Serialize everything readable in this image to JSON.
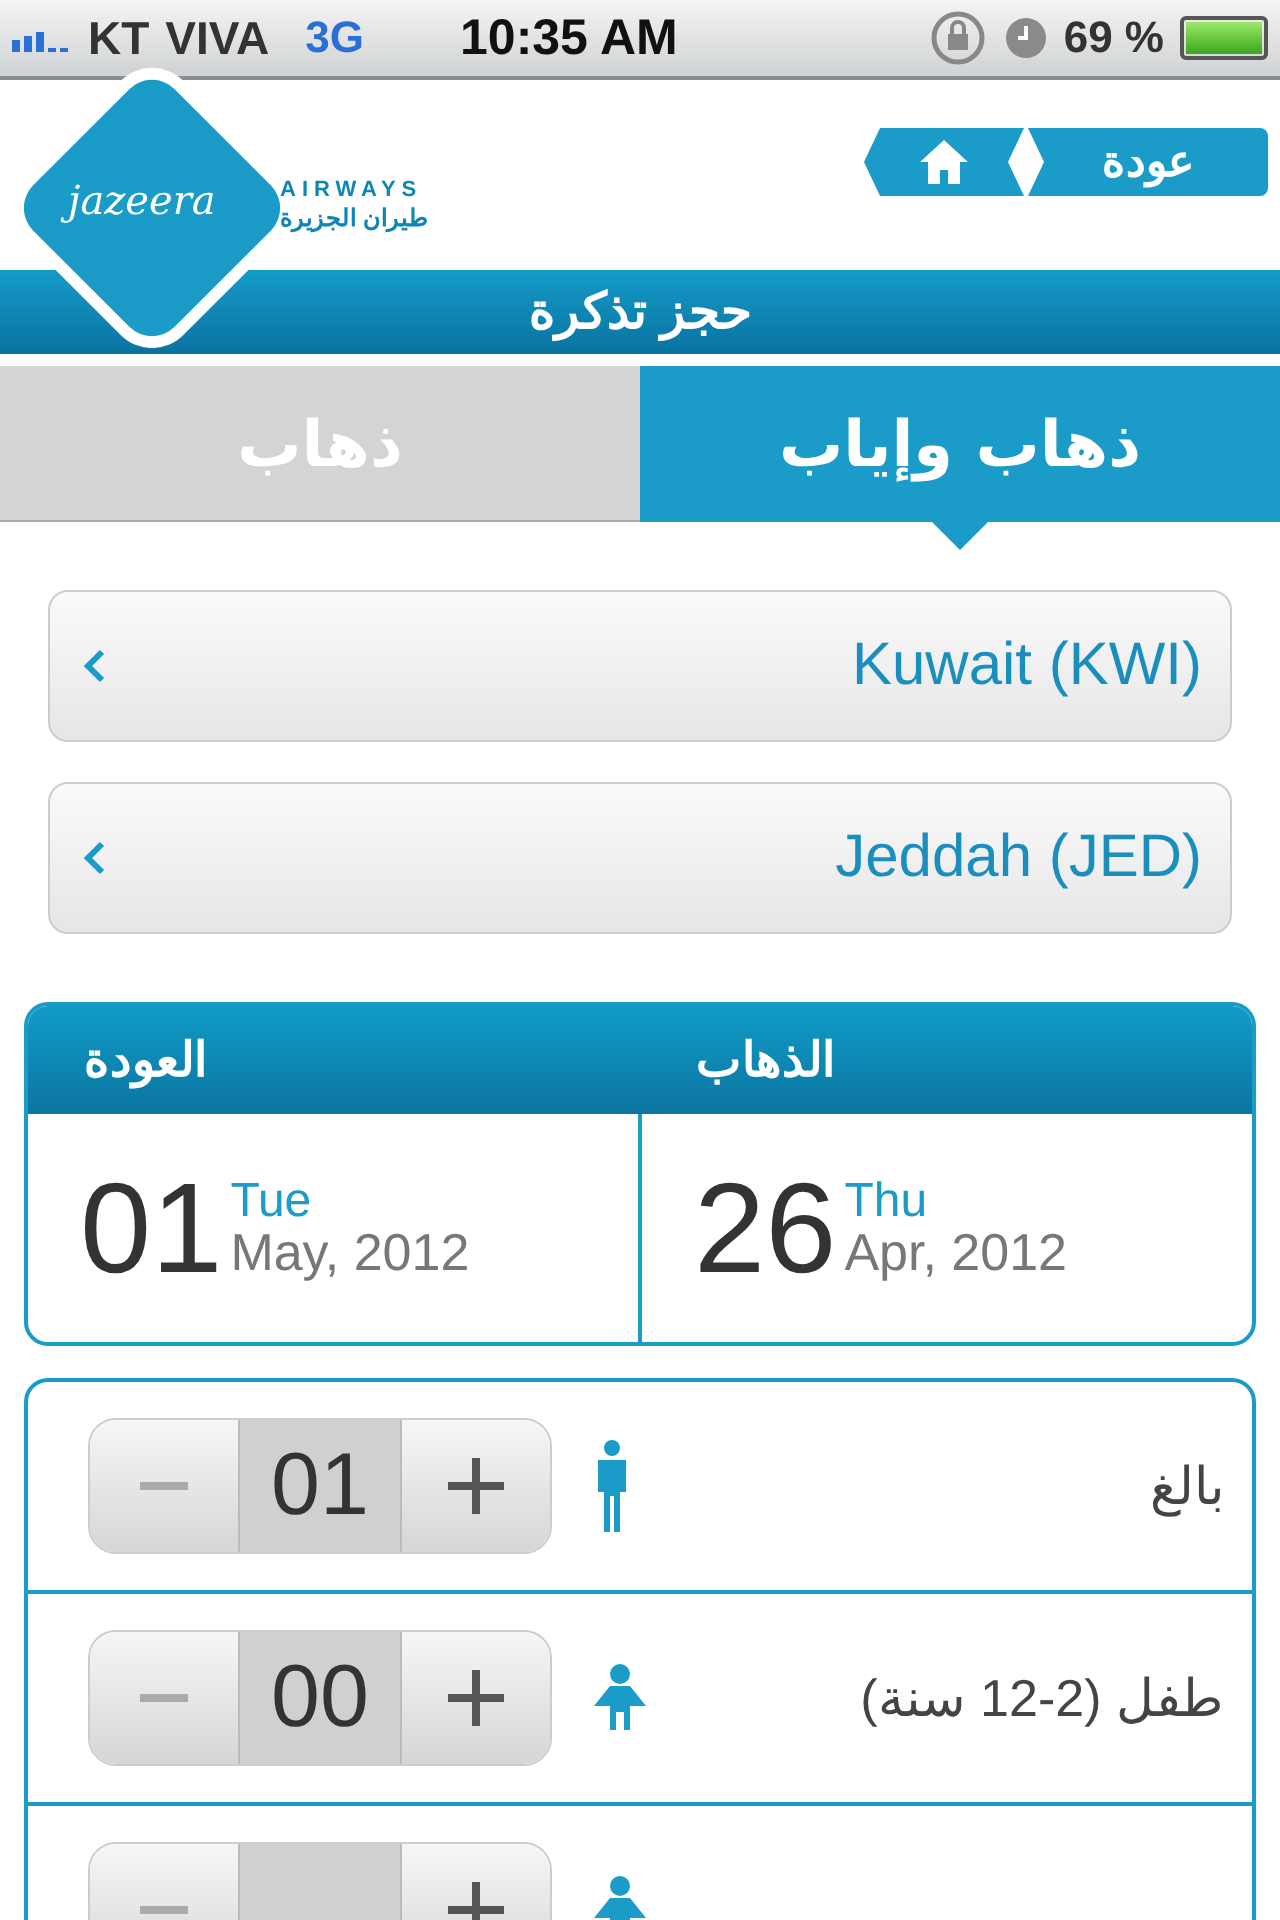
{
  "status_bar": {
    "carrier": "KT",
    "carrier_2": "VIVA",
    "network": "3G",
    "time": "10:35 AM",
    "battery": "69 %"
  },
  "header": {
    "logo_name": "jazeera",
    "logo_airways": "AIRWAYS",
    "logo_arabic": "طيران الجزيرة",
    "back_button": "عودة"
  },
  "title": "حجز تذكرة",
  "tabs": [
    {
      "label": "ذهاب وإياب",
      "selected": true
    },
    {
      "label": "ذهاب",
      "selected": false
    }
  ],
  "route_fields": [
    {
      "value": "Kuwait (KWI)"
    },
    {
      "value": "Jeddah (JED)"
    }
  ],
  "dates": [
    {
      "heading": "الذهاب",
      "day": "26",
      "weekday": "Thu",
      "month_year": "Apr, 2012"
    },
    {
      "heading": "العودة",
      "day": "01",
      "weekday": "Tue",
      "month_year": "May, 2012"
    }
  ],
  "passengers": [
    {
      "kind": "adult",
      "label": "بالغ",
      "count": "01"
    },
    {
      "kind": "child",
      "label": "طفل (2-12 سنة)",
      "count": "00"
    },
    {
      "kind": "child"
    }
  ]
}
